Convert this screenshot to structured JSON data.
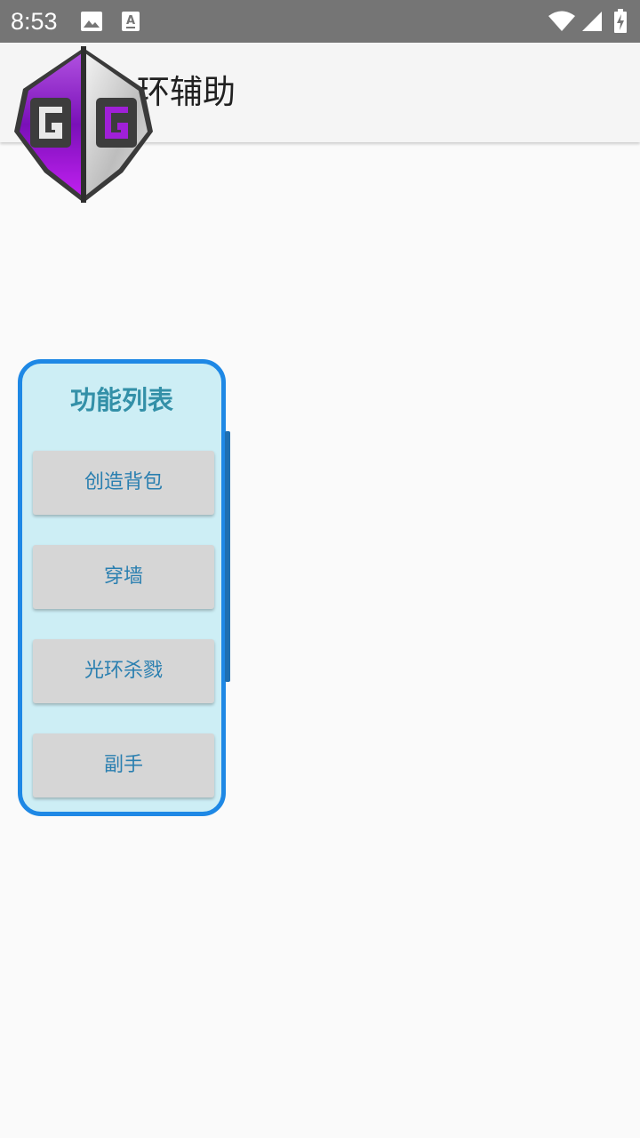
{
  "status_bar": {
    "time": "8:53",
    "left_icons": [
      "image-icon",
      "text-a-icon"
    ],
    "right_icons": [
      "wifi-icon",
      "signal-icon",
      "battery-charging-icon"
    ]
  },
  "app_bar": {
    "title": "环辅助",
    "logo_icon": "game-guardian-logo-icon"
  },
  "panel": {
    "title": "功能列表",
    "buttons": [
      {
        "label": "创造背包"
      },
      {
        "label": "穿墙"
      },
      {
        "label": "光环杀戮"
      },
      {
        "label": "副手"
      }
    ]
  },
  "colors": {
    "status_bar": "#757575",
    "panel_border": "#1e88e5",
    "panel_bg": "#cdeef5",
    "panel_title": "#3390a8",
    "button_text": "#2a7fb0",
    "button_bg": "#d6d6d6"
  }
}
